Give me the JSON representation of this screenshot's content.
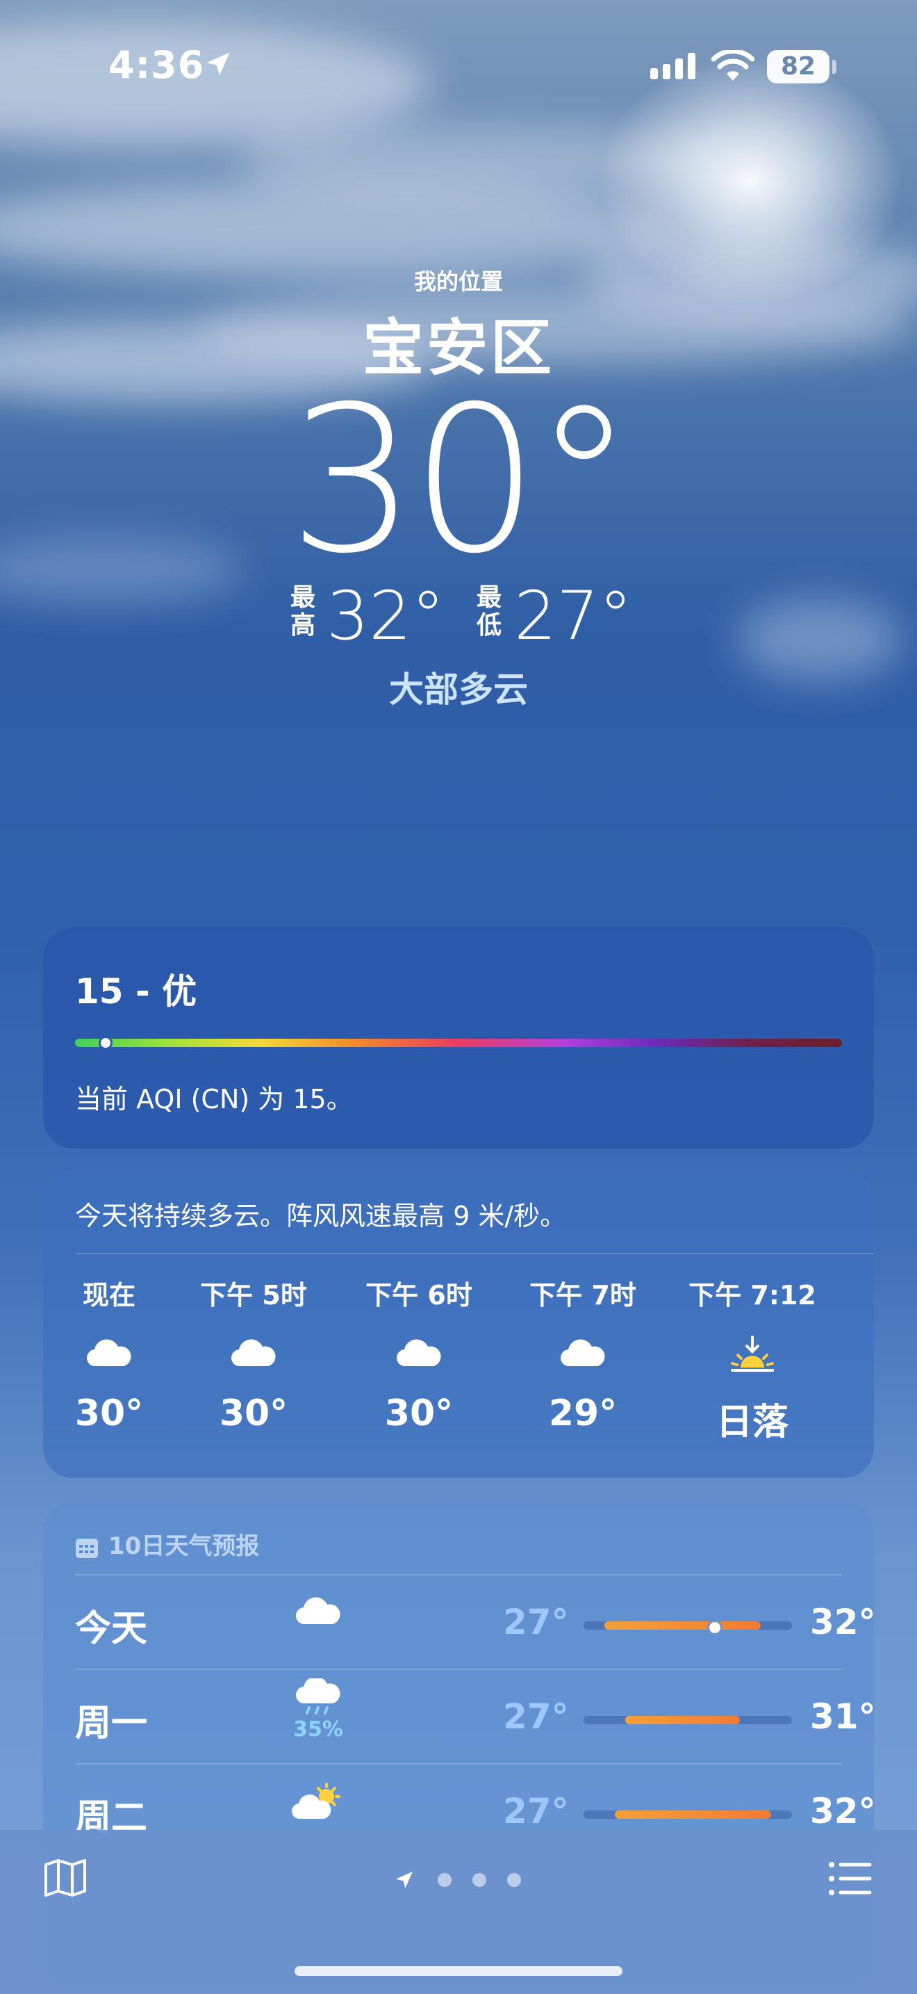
{
  "status": {
    "time": "4:36",
    "battery": "82"
  },
  "location": {
    "my_location": "我的位置",
    "city": "宝安区"
  },
  "current": {
    "temp": "30°",
    "high_label": "最高",
    "high": "32°",
    "low_label": "最低",
    "low": "27°",
    "condition": "大部多云"
  },
  "aqi": {
    "title": "15 - 优",
    "value": 15,
    "description": "当前 AQI (CN) 为 15。"
  },
  "hourly": {
    "summary": "今天将持续多云。阵风风速最高 9 米/秒。",
    "items": [
      {
        "label": "现在",
        "icon": "cloud-icon",
        "value": "30°"
      },
      {
        "label": "下午 5时",
        "icon": "cloud-icon",
        "value": "30°"
      },
      {
        "label": "下午 6时",
        "icon": "cloud-icon",
        "value": "30°"
      },
      {
        "label": "下午 7时",
        "icon": "cloud-icon",
        "value": "29°"
      },
      {
        "label": "下午 7:12",
        "icon": "sunset-icon",
        "value": "日落"
      }
    ]
  },
  "daily": {
    "header": "10日天气预报",
    "rows": [
      {
        "day": "今天",
        "icon": "cloud-icon",
        "low": "27°",
        "high": "32°",
        "precip": "",
        "range_start": 0.1,
        "range_end": 0.85,
        "current": 0.62
      },
      {
        "day": "周一",
        "icon": "cloud-rain-icon",
        "low": "27°",
        "high": "31°",
        "precip": "35%",
        "range_start": 0.2,
        "range_end": 0.75
      },
      {
        "day": "周二",
        "icon": "partly-sunny-icon",
        "low": "27°",
        "high": "32°",
        "precip": "",
        "range_start": 0.15,
        "range_end": 0.9
      }
    ]
  }
}
